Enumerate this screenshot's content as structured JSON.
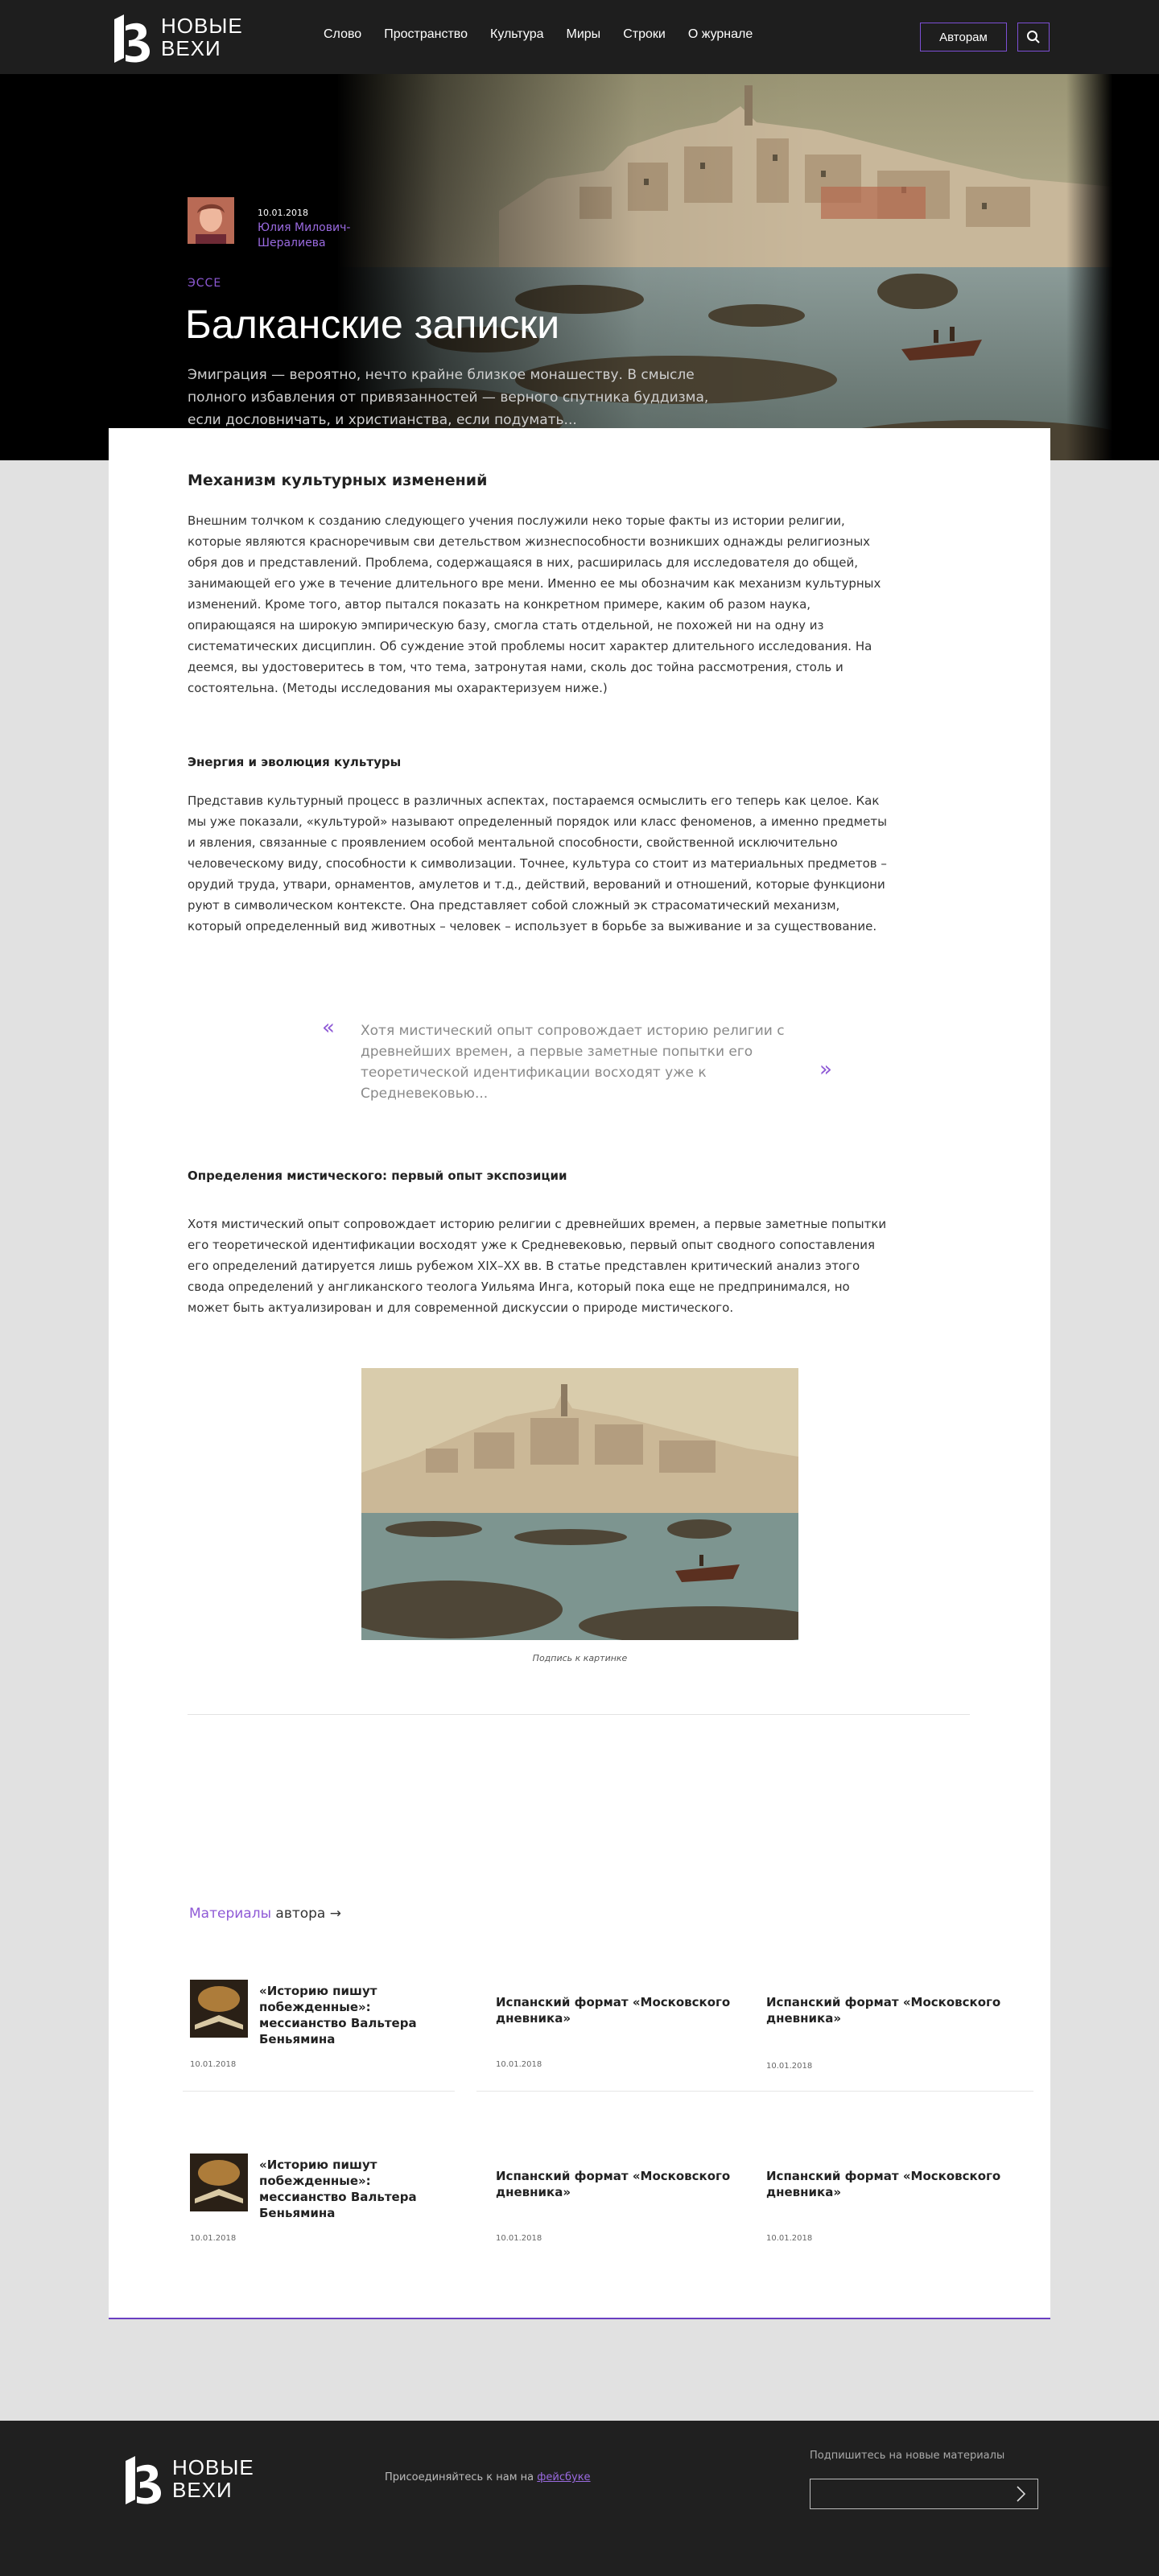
{
  "header": {
    "logo_line1": "НОВЫЕ",
    "logo_line2": "ВЕХИ",
    "nav": [
      "Слово",
      "Пространство",
      "Культура",
      "Миры",
      "Строки",
      "О журнале"
    ],
    "authors_button": "Авторам",
    "search_icon": "search-icon"
  },
  "hero": {
    "date": "10.01.2018",
    "author": "Юлия Милович-Шералиева",
    "kicker": "ЭССЕ",
    "title": "Балканские записки",
    "lead": "Эмиграция — вероятно, нечто крайне близкое монашеству. В смысле полного избавления от привязанностей — верного спутника буддизма, если дословничать, и христианства, если подумать..."
  },
  "article": {
    "h2": "Механизм культурных изменений",
    "p1": "Внешним толчком к созданию следующего учения послужили неко торые факты из истории религии, которые являются красноречивым сви детельством жизнеспособности возникших однажды религиозных обря дов и представлений. Проблема, содержащаяся в них, расширилась для исследователя до общей, занимающей его уже в течение длительного вре мени. Именно ее мы обозначим как механизм культурных изменений. Кроме того, автор пытался показать на конкретном примере, каким об разом наука, опирающаяся на широкую эмпирическую базу, смогла стать отдельной, не похожей ни на одну из систематических дисциплин. Об суждение этой проблемы носит характер длительного исследования. На деемся, вы удостоверитесь в том, что тема, затронутая нами, сколь дос тойна рассмотрения, столь и состоятельна. (Методы исследования мы охарактеризуем ниже.)",
    "h3a": "Энергия и эволюция культуры",
    "p2": "Представив культурный процесс в различных аспектах, постараемся осмыслить его теперь как целое. Как мы уже показали, «культурой» называют определенный порядок или класс феноменов, а именно предметы и явления, связанные с проявлением особой ментальной способности, свойственной исключительно человеческому виду, способности к символизации. Точнее, культура со стоит из материальных предметов – орудий труда, утвари, орнаментов, амулетов и т.д., действий, верований и отношений, которые функциони руют в символическом контексте. Она представляет собой сложный эк страсоматический механизм, который определенный вид животных – человек – использует в борьбе за выживание и за существование.",
    "quote": "Хотя мистический опыт сопровождает историю религии с древнейших времен, а первые заметные попытки его теоретической идентификации восходят уже к Средневековью...",
    "quote_open": "«",
    "quote_close": "»",
    "h3b": "Определения мистического: первый опыт экспозиции",
    "p3": "Хотя мистический опыт сопровождает историю религии с древнейших времен, а первые заметные попытки его теоретической идентификации восходят уже к Средневековью, первый опыт сводного сопоставления его определений датируется лишь рубежом XIX–XX вв. В статье представлен критический анализ этого свода определений у англиканского теолога Уильяма Инга, который пока еще не предпринимался, но может быть актуализирован и для современной дискуссии о природе мистического.",
    "caption": "Подпись к картинке"
  },
  "materials": {
    "label_a": "Материалы",
    "label_b": " автора →",
    "items": [
      {
        "title": "«Историю пишут побежденные»: мессианство Вальтера Беньямина",
        "date": "10.01.2018"
      },
      {
        "title": "Испанский формат «Московского дневника»",
        "date": "10.01.2018"
      },
      {
        "title": "Испанский формат «Московского дневника»",
        "date": "10.01.2018"
      },
      {
        "title": "«Историю пишут побежденные»: мессианство Вальтера Беньямина",
        "date": "10.01.2018"
      },
      {
        "title": "Испанский формат «Московского дневника»",
        "date": "10.01.2018"
      },
      {
        "title": "Испанский формат «Московского дневника»",
        "date": "10.01.2018"
      }
    ]
  },
  "footer": {
    "logo_line1": "НОВЫЕ",
    "logo_line2": "ВЕХИ",
    "join_text": "Присоединяйтесь к нам на ",
    "join_link": "фейсбуке",
    "subscribe_label": "Подпишитесь на новые материалы",
    "subscribe_placeholder": ""
  },
  "colors": {
    "accent": "#7d4fd6",
    "header_bg": "#1e1e1e",
    "page_bg": "#e1e1e1"
  }
}
